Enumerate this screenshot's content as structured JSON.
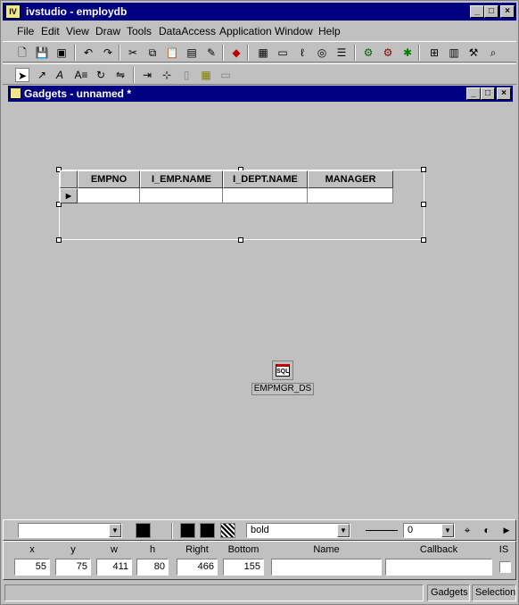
{
  "window": {
    "title": "ivstudio - employdb",
    "app_icon": "IV",
    "controls": [
      "_",
      "□",
      "×"
    ]
  },
  "menu": [
    "File",
    "Edit",
    "View",
    "Draw",
    "Tools",
    "DataAccess",
    "Application",
    "Window",
    "Help"
  ],
  "toolbar1": [
    "new-file-icon",
    "save-icon",
    "save-all-icon",
    "undo-icon",
    "redo-icon",
    "cut-icon",
    "copy-icon",
    "paste-icon",
    "paste-special-icon",
    "eraser-icon",
    "record-icon",
    "gadget-icon",
    "form-icon",
    "script-icon",
    "inspector-icon",
    "list-icon",
    "run-icon",
    "debug-icon",
    "build-icon",
    "grid-icon",
    "layout-icon",
    "tools-icon",
    "zoom-icon"
  ],
  "toolbar2": [
    "select-arrow-icon",
    "node-edit-icon",
    "text-tool-icon",
    "text-format-icon",
    "rotate-icon",
    "flip-icon",
    "align-icon",
    "snap-icon",
    "ruler-icon",
    "grid-toggle-icon",
    "link-icon"
  ],
  "child": {
    "title": "Gadgets - unnamed *",
    "controls": [
      "_",
      "□",
      "×"
    ]
  },
  "grid": {
    "columns": [
      "EMPNO",
      "I_EMP.NAME",
      "I_DEPT.NAME",
      "MANAGER"
    ],
    "row_marker": "▶"
  },
  "datasource": {
    "icon_text": "SQL",
    "label": "EMPMGR_DS"
  },
  "attrs": {
    "font_combo": "",
    "font_style": "bold",
    "line_width": "0"
  },
  "geometry": {
    "labels": [
      "x",
      "y",
      "w",
      "h",
      "Right",
      "Bottom",
      "Name",
      "Callback",
      "IS"
    ],
    "values": {
      "x": "55",
      "y": "75",
      "w": "411",
      "h": "80",
      "right": "466",
      "bottom": "155",
      "name": "",
      "callback": ""
    }
  },
  "status": {
    "gadgets": "Gadgets",
    "selection": "Selection"
  }
}
